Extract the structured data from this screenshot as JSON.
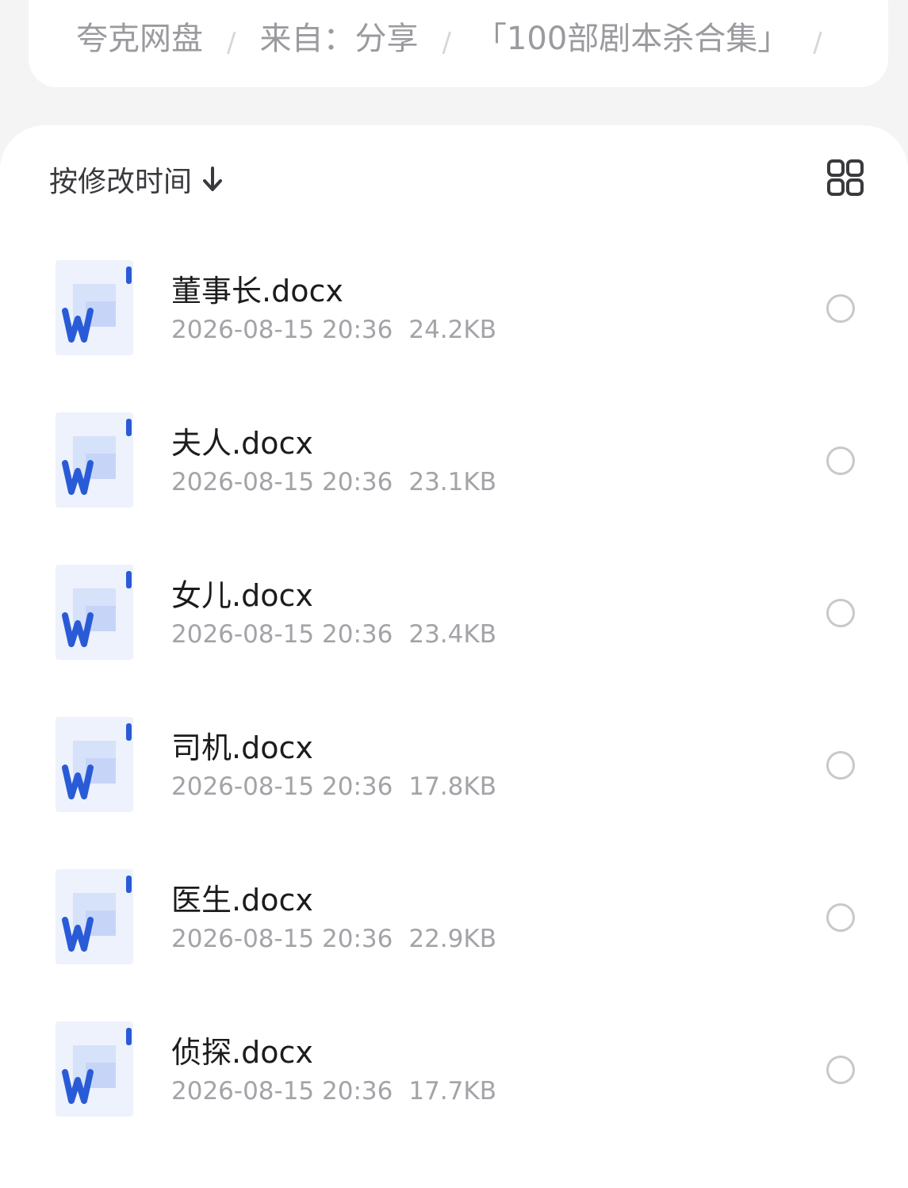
{
  "breadcrumb": {
    "items": [
      "夸克网盘",
      "来自：分享",
      "「100部剧本杀合集」"
    ],
    "separator": "/"
  },
  "sort": {
    "label": "按修改时间",
    "direction_icon": "arrow-down-icon"
  },
  "view_toggle_icon": "grid-view-icon",
  "files": [
    {
      "name": "董事长.docx",
      "date": "2026-08-15 20:36",
      "size": "24.2KB",
      "icon": "word-doc-icon"
    },
    {
      "name": "夫人.docx",
      "date": "2026-08-15 20:36",
      "size": "23.1KB",
      "icon": "word-doc-icon"
    },
    {
      "name": "女儿.docx",
      "date": "2026-08-15 20:36",
      "size": "23.4KB",
      "icon": "word-doc-icon"
    },
    {
      "name": "司机.docx",
      "date": "2026-08-15 20:36",
      "size": "17.8KB",
      "icon": "word-doc-icon"
    },
    {
      "name": "医生.docx",
      "date": "2026-08-15 20:36",
      "size": "22.9KB",
      "icon": "word-doc-icon"
    },
    {
      "name": "侦探.docx",
      "date": "2026-08-15 20:36",
      "size": "17.7KB",
      "icon": "word-doc-icon"
    }
  ],
  "colors": {
    "word_blue": "#2a5bd7",
    "background": "#f4f4f5",
    "panel": "#ffffff"
  }
}
